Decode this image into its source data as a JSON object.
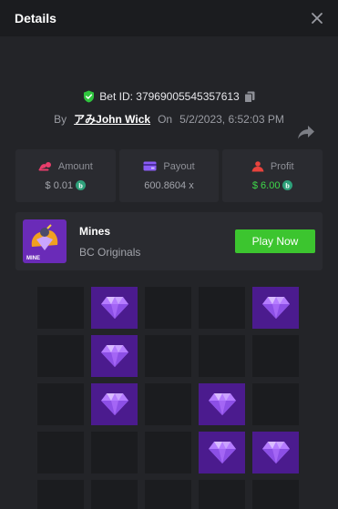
{
  "header": {
    "title": "Details",
    "close_icon": "close-icon"
  },
  "bet": {
    "id_label": "Bet ID: 37969005545357613",
    "by_label": "By",
    "user": "アみJohn Wick",
    "on_label": "On",
    "datetime": "5/2/2023, 6:52:03 PM"
  },
  "stats": {
    "amount": {
      "label": "Amount",
      "value": "$ 0.01"
    },
    "payout": {
      "label": "Payout",
      "value": "600.8604 x"
    },
    "profit": {
      "label": "Profit",
      "value": "$ 6.00"
    }
  },
  "game": {
    "name": "Mines",
    "provider": "BC Originals",
    "play_label": "Play Now",
    "thumb_text": "MINE"
  },
  "mines_grid": {
    "columns": 5,
    "cells": [
      "empty",
      "gem",
      "empty",
      "empty",
      "gem",
      "empty",
      "gem",
      "empty",
      "empty",
      "empty",
      "empty",
      "gem",
      "empty",
      "gem",
      "empty",
      "empty",
      "empty",
      "empty",
      "gem",
      "gem",
      "empty",
      "empty",
      "empty",
      "empty",
      "empty"
    ]
  },
  "colors": {
    "background": "#232428",
    "header": "#1b1c1f",
    "card": "#2a2b30",
    "accent_green": "#3cc52f",
    "profit_green": "#3fd84a",
    "gem_tile": "#4b1b8e",
    "empty_tile": "#1b1c1f"
  }
}
